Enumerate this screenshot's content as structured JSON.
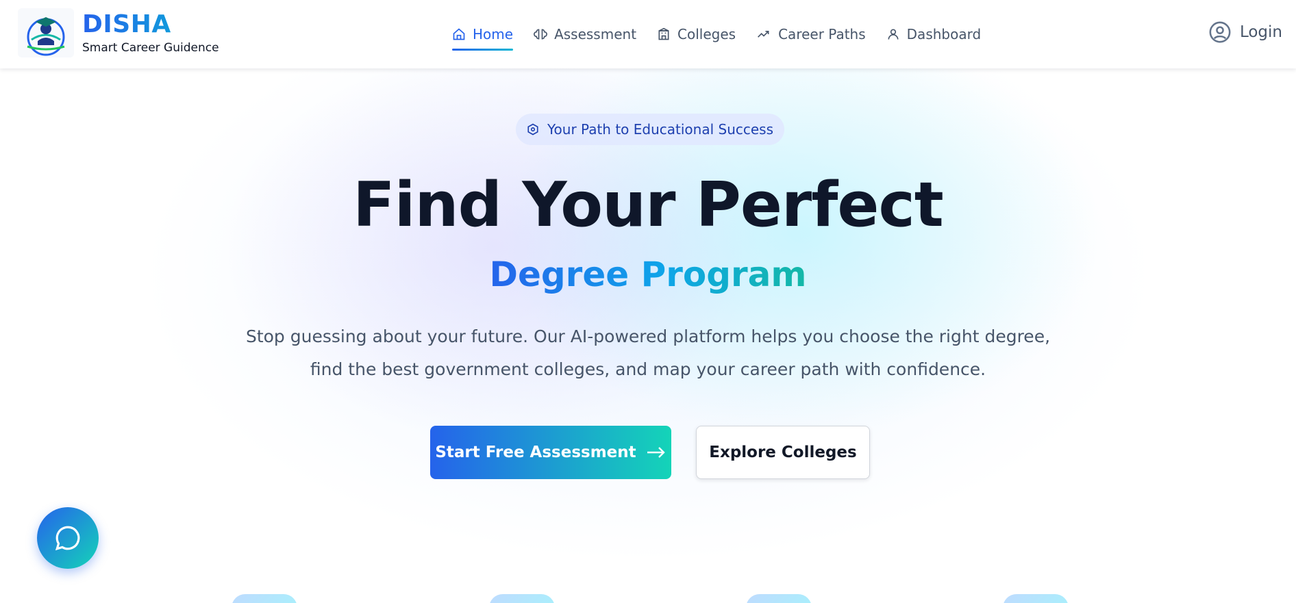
{
  "brand": {
    "name": "DISHA",
    "tagline": "Smart Career Guidence",
    "logo_icon": "graduate-book-logo"
  },
  "nav": {
    "items": [
      {
        "label": "Home",
        "icon": "home-icon",
        "active": true
      },
      {
        "label": "Assessment",
        "icon": "brain-icon",
        "active": false
      },
      {
        "label": "Colleges",
        "icon": "building-icon",
        "active": false
      },
      {
        "label": "Career Paths",
        "icon": "trend-icon",
        "active": false
      },
      {
        "label": "Dashboard",
        "icon": "user-icon",
        "active": false
      }
    ],
    "login_label": "Login"
  },
  "hero": {
    "badge": "Your Path to Educational Success",
    "title": "Find Your Perfect",
    "subtitle": "Degree Program",
    "description_line1": "Stop guessing about your future. Our AI-powered platform helps you choose the right degree,",
    "description_line2": "find the best government colleges, and map your career path with confidence.",
    "primary_cta": "Start Free Assessment",
    "secondary_cta": "Explore Colleges"
  },
  "colors": {
    "brand_blue": "#2563eb",
    "brand_teal": "#14d4b8",
    "text_dark": "#0f172a",
    "text_muted": "#475569"
  }
}
